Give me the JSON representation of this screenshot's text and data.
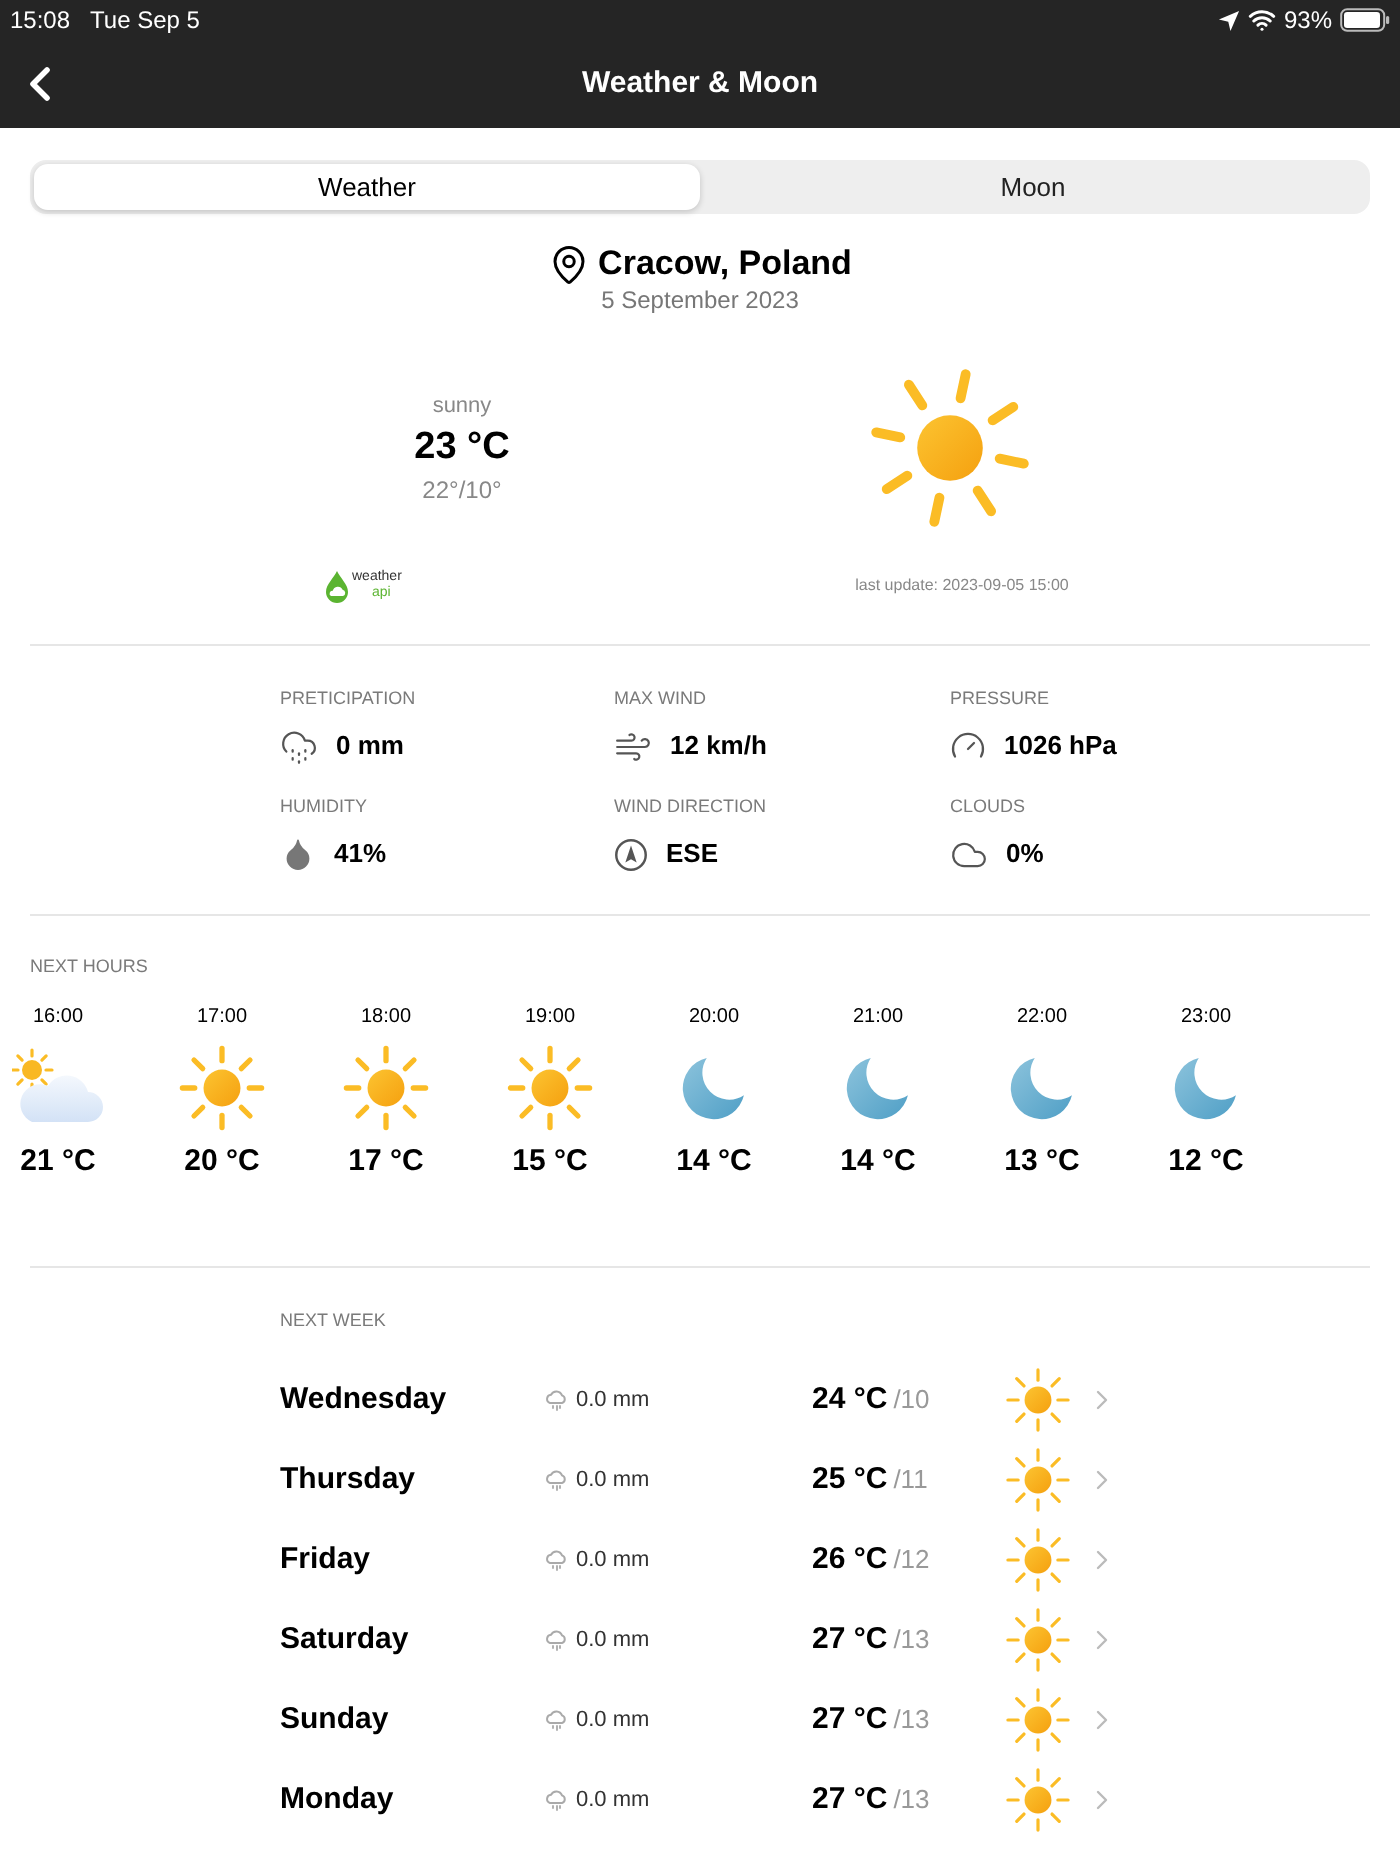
{
  "status_bar": {
    "time": "15:08",
    "date": "Tue Sep 5",
    "battery": "93%"
  },
  "nav_bar": {
    "title": "Weather & Moon"
  },
  "tabs": [
    {
      "label": "Weather",
      "selected": true
    },
    {
      "label": "Moon",
      "selected": false
    }
  ],
  "location": {
    "name": "Cracow, Poland",
    "date": "5 September 2023"
  },
  "current": {
    "condition": "sunny",
    "kind": "sunny",
    "temperature": "23 °C",
    "range": "22°/10°",
    "provider": {
      "name": "weather",
      "suffix": "api"
    },
    "last_update": "last update: 2023-09-05 15:00"
  },
  "details": [
    {
      "kind": "precipitation",
      "label": "PRETICIPATION",
      "value": "0 mm"
    },
    {
      "kind": "wind",
      "label": "MAX WIND",
      "value": "12 km/h"
    },
    {
      "kind": "pressure",
      "label": "PRESSURE",
      "value": "1026 hPa"
    },
    {
      "kind": "humidity",
      "label": "HUMIDITY",
      "value": "41%"
    },
    {
      "kind": "direction",
      "label": "WIND DIRECTION",
      "value": "ESE"
    },
    {
      "kind": "clouds",
      "label": "CLOUDS",
      "value": "0%"
    }
  ],
  "next_hours": {
    "title": "NEXT HOURS",
    "hours": [
      {
        "time": "16:00",
        "kind": "cloudy",
        "temperature": "21 °C"
      },
      {
        "time": "17:00",
        "kind": "sunny",
        "temperature": "20 °C"
      },
      {
        "time": "18:00",
        "kind": "sunny",
        "temperature": "17 °C"
      },
      {
        "time": "19:00",
        "kind": "sunny",
        "temperature": "15 °C"
      },
      {
        "time": "20:00",
        "kind": "night",
        "temperature": "14 °C"
      },
      {
        "time": "21:00",
        "kind": "night",
        "temperature": "14 °C"
      },
      {
        "time": "22:00",
        "kind": "night",
        "temperature": "13 °C"
      },
      {
        "time": "23:00",
        "kind": "night",
        "temperature": "12 °C"
      }
    ]
  },
  "next_week": {
    "title": "NEXT WEEK",
    "days": [
      {
        "day": "Wednesday",
        "precipitation": "0.0 mm",
        "high": "24 °C",
        "low": "/10",
        "kind": "sunny"
      },
      {
        "day": "Thursday",
        "precipitation": "0.0 mm",
        "high": "25 °C",
        "low": "/11",
        "kind": "sunny"
      },
      {
        "day": "Friday",
        "precipitation": "0.0 mm",
        "high": "26 °C",
        "low": "/12",
        "kind": "sunny"
      },
      {
        "day": "Saturday",
        "precipitation": "0.0 mm",
        "high": "27 °C",
        "low": "/13",
        "kind": "sunny"
      },
      {
        "day": "Sunday",
        "precipitation": "0.0 mm",
        "high": "27 °C",
        "low": "/13",
        "kind": "sunny"
      },
      {
        "day": "Monday",
        "precipitation": "0.0 mm",
        "high": "27 °C",
        "low": "/13",
        "kind": "sunny"
      }
    ]
  }
}
